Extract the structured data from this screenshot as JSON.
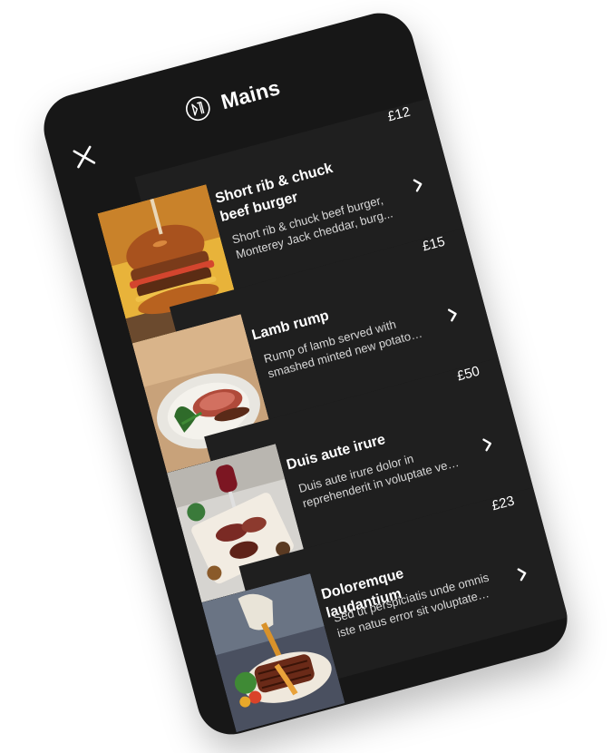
{
  "header": {
    "title": "Mains"
  },
  "items": [
    {
      "name": "Short rib & chuck beef burger",
      "desc1": "Short rib & chuck beef burger,",
      "desc2": "Monterey Jack cheddar, burg...",
      "price": "£12"
    },
    {
      "name": "Lamb rump",
      "desc1": "Rump of lamb served with",
      "desc2": "smashed minted new potatoe...",
      "price": "£15"
    },
    {
      "name": "Duis aute irure",
      "desc1": "Duis aute irure dolor in",
      "desc2": "reprehenderit in voluptate veli...",
      "price": "£50"
    },
    {
      "name": "Doloremque laudantium",
      "desc1": "Sed ut perspiciatis unde omnis",
      "desc2": "iste natus error sit voluptatem...",
      "price": "£23"
    }
  ]
}
